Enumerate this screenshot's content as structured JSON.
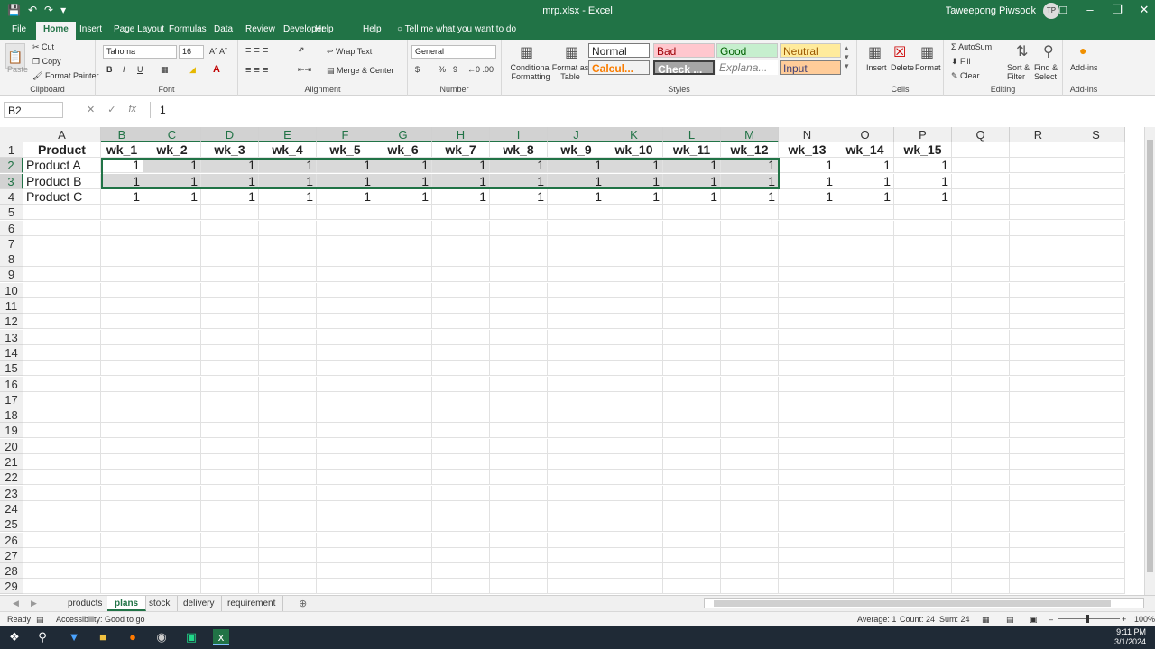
{
  "window": {
    "title": "mrp.xlsx  -  Excel",
    "user": "Taweepong Piwsook",
    "avatar": "TP"
  },
  "ribbon_tabs": [
    "File",
    "Home",
    "Insert",
    "Page Layout",
    "Formulas",
    "Data",
    "Review",
    "Developer",
    "Help"
  ],
  "tell_me": "Tell me what you want to do",
  "clipboard": {
    "paste": "Paste",
    "cut": "Cut",
    "copy": "Copy",
    "format_painter": "Format Painter",
    "label": "Clipboard"
  },
  "font": {
    "name": "Tahoma",
    "size": "16",
    "label": "Font",
    "bold": "B",
    "italic": "I",
    "underline": "U"
  },
  "alignment": {
    "wrap": "Wrap Text",
    "merge": "Merge & Center",
    "label": "Alignment"
  },
  "number": {
    "format": "General",
    "currency": "$",
    "percent": "%",
    "comma": "9",
    "label": "Number"
  },
  "styles": {
    "conditional": "Conditional Formatting",
    "format_table": "Format as Table",
    "normal": "Normal",
    "bad": "Bad",
    "good": "Good",
    "neutral": "Neutral",
    "calc": "Calcul...",
    "check": "Check ...",
    "explan": "Explana...",
    "input": "Input",
    "label": "Styles"
  },
  "cells_group": {
    "insert": "Insert",
    "delete": "Delete",
    "format": "Format",
    "label": "Cells"
  },
  "editing": {
    "autosum": "AutoSum",
    "fill": "Fill",
    "clear": "Clear",
    "sort": "Sort & Filter",
    "find": "Find & Select",
    "label": "Editing"
  },
  "addins": {
    "addins": "Add-ins",
    "label": "Add-ins"
  },
  "formula_bar": {
    "name_box": "B2",
    "content": "1"
  },
  "columns": [
    "A",
    "B",
    "C",
    "D",
    "E",
    "F",
    "G",
    "H",
    "I",
    "J",
    "K",
    "L",
    "M",
    "N",
    "O",
    "P",
    "Q",
    "R",
    "S"
  ],
  "rows": [
    "1",
    "2",
    "3",
    "4",
    "5",
    "6",
    "7",
    "8",
    "9",
    "10",
    "11",
    "12",
    "13",
    "14",
    "15",
    "16",
    "17",
    "18",
    "19",
    "20",
    "21",
    "22",
    "23",
    "24",
    "25",
    "26",
    "27",
    "28",
    "29"
  ],
  "grid": {
    "headers": [
      "Product",
      "wk_1",
      "wk_2",
      "wk_3",
      "wk_4",
      "wk_5",
      "wk_6",
      "wk_7",
      "wk_8",
      "wk_9",
      "wk_10",
      "wk_11",
      "wk_12",
      "wk_13",
      "wk_14",
      "wk_15"
    ],
    "data": [
      [
        "Product A",
        "1",
        "1",
        "1",
        "1",
        "1",
        "1",
        "1",
        "1",
        "1",
        "1",
        "1",
        "1",
        "1",
        "1",
        "1"
      ],
      [
        "Product B",
        "1",
        "1",
        "1",
        "1",
        "1",
        "1",
        "1",
        "1",
        "1",
        "1",
        "1",
        "1",
        "1",
        "1",
        "1"
      ],
      [
        "Product C",
        "1",
        "1",
        "1",
        "1",
        "1",
        "1",
        "1",
        "1",
        "1",
        "1",
        "1",
        "1",
        "1",
        "1",
        "1"
      ]
    ]
  },
  "sheet_tabs": [
    "products",
    "plans",
    "stock",
    "delivery",
    "requirement"
  ],
  "active_sheet": "plans",
  "status": {
    "ready": "Ready",
    "accessibility": "Accessibility: Good to go",
    "average": "Average: 1",
    "count": "Count: 24",
    "sum": "Sum: 24",
    "zoom": "100%"
  },
  "clock": {
    "time": "9:11 PM",
    "date": "3/1/2024"
  },
  "colors": {
    "excel_green": "#217346",
    "selection": "#d9d9d9"
  }
}
